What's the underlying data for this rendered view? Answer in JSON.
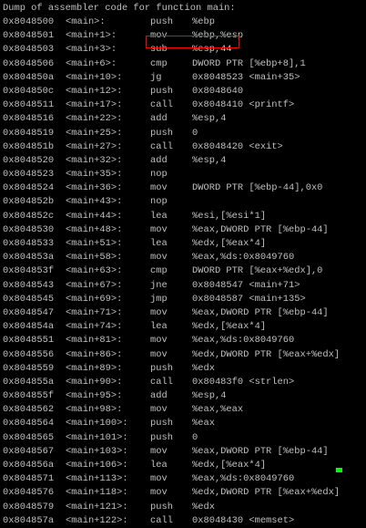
{
  "terminal": {
    "header": "Dump of assembler code for function main:",
    "colors": {
      "background": "#000000",
      "text": "#c0c0c0",
      "highlight_border": "#ff0000",
      "cursor": "#00ff00"
    },
    "highlighted_instruction": "sub    %esp,44",
    "lines": [
      {
        "addr": "0x8048500",
        "sym": "<main>:",
        "op": "push",
        "arg": "%ebp"
      },
      {
        "addr": "0x8048501",
        "sym": "<main+1>:",
        "op": "mov",
        "arg": "%ebp,%esp"
      },
      {
        "addr": "0x8048503",
        "sym": "<main+3>:",
        "op": "sub",
        "arg": "%esp,44"
      },
      {
        "addr": "0x8048506",
        "sym": "<main+6>:",
        "op": "cmp",
        "arg": "DWORD PTR [%ebp+8],1"
      },
      {
        "addr": "0x804850a",
        "sym": "<main+10>:",
        "op": "jg",
        "arg": "0x8048523 <main+35>"
      },
      {
        "addr": "0x804850c",
        "sym": "<main+12>:",
        "op": "push",
        "arg": "0x8048640"
      },
      {
        "addr": "0x8048511",
        "sym": "<main+17>:",
        "op": "call",
        "arg": "0x8048410 <printf>"
      },
      {
        "addr": "0x8048516",
        "sym": "<main+22>:",
        "op": "add",
        "arg": "%esp,4"
      },
      {
        "addr": "0x8048519",
        "sym": "<main+25>:",
        "op": "push",
        "arg": "0"
      },
      {
        "addr": "0x804851b",
        "sym": "<main+27>:",
        "op": "call",
        "arg": "0x8048420 <exit>"
      },
      {
        "addr": "0x8048520",
        "sym": "<main+32>:",
        "op": "add",
        "arg": "%esp,4"
      },
      {
        "addr": "0x8048523",
        "sym": "<main+35>:",
        "op": "nop",
        "arg": ""
      },
      {
        "addr": "0x8048524",
        "sym": "<main+36>:",
        "op": "mov",
        "arg": "DWORD PTR [%ebp-44],0x0"
      },
      {
        "addr": "0x804852b",
        "sym": "<main+43>:",
        "op": "nop",
        "arg": ""
      },
      {
        "addr": "0x804852c",
        "sym": "<main+44>:",
        "op": "lea",
        "arg": "%esi,[%esi*1]"
      },
      {
        "addr": "0x8048530",
        "sym": "<main+48>:",
        "op": "mov",
        "arg": "%eax,DWORD PTR [%ebp-44]"
      },
      {
        "addr": "0x8048533",
        "sym": "<main+51>:",
        "op": "lea",
        "arg": "%edx,[%eax*4]"
      },
      {
        "addr": "0x804853a",
        "sym": "<main+58>:",
        "op": "mov",
        "arg": "%eax,%ds:0x8049760"
      },
      {
        "addr": "0x804853f",
        "sym": "<main+63>:",
        "op": "cmp",
        "arg": "DWORD PTR [%eax+%edx],0"
      },
      {
        "addr": "0x8048543",
        "sym": "<main+67>:",
        "op": "jne",
        "arg": "0x8048547 <main+71>"
      },
      {
        "addr": "0x8048545",
        "sym": "<main+69>:",
        "op": "jmp",
        "arg": "0x8048587 <main+135>"
      },
      {
        "addr": "0x8048547",
        "sym": "<main+71>:",
        "op": "mov",
        "arg": "%eax,DWORD PTR [%ebp-44]"
      },
      {
        "addr": "0x804854a",
        "sym": "<main+74>:",
        "op": "lea",
        "arg": "%edx,[%eax*4]"
      },
      {
        "addr": "0x8048551",
        "sym": "<main+81>:",
        "op": "mov",
        "arg": "%eax,%ds:0x8049760"
      },
      {
        "addr": "0x8048556",
        "sym": "<main+86>:",
        "op": "mov",
        "arg": "%edx,DWORD PTR [%eax+%edx]"
      },
      {
        "addr": "0x8048559",
        "sym": "<main+89>:",
        "op": "push",
        "arg": "%edx"
      },
      {
        "addr": "0x804855a",
        "sym": "<main+90>:",
        "op": "call",
        "arg": "0x80483f0 <strlen>"
      },
      {
        "addr": "0x804855f",
        "sym": "<main+95>:",
        "op": "add",
        "arg": "%esp,4"
      },
      {
        "addr": "0x8048562",
        "sym": "<main+98>:",
        "op": "mov",
        "arg": "%eax,%eax"
      },
      {
        "addr": "0x8048564",
        "sym": "<main+100>:",
        "op": "push",
        "arg": "%eax"
      },
      {
        "addr": "0x8048565",
        "sym": "<main+101>:",
        "op": "push",
        "arg": "0"
      },
      {
        "addr": "0x8048567",
        "sym": "<main+103>:",
        "op": "mov",
        "arg": "%eax,DWORD PTR [%ebp-44]"
      },
      {
        "addr": "0x804856a",
        "sym": "<main+106>:",
        "op": "lea",
        "arg": "%edx,[%eax*4]"
      },
      {
        "addr": "0x8048571",
        "sym": "<main+113>:",
        "op": "mov",
        "arg": "%eax,%ds:0x8049760"
      },
      {
        "addr": "0x8048576",
        "sym": "<main+118>:",
        "op": "mov",
        "arg": "%edx,DWORD PTR [%eax+%edx]"
      },
      {
        "addr": "0x8048579",
        "sym": "<main+121>:",
        "op": "push",
        "arg": "%edx"
      },
      {
        "addr": "0x804857a",
        "sym": "<main+122>:",
        "op": "call",
        "arg": "0x8048430 <memset>"
      }
    ]
  }
}
